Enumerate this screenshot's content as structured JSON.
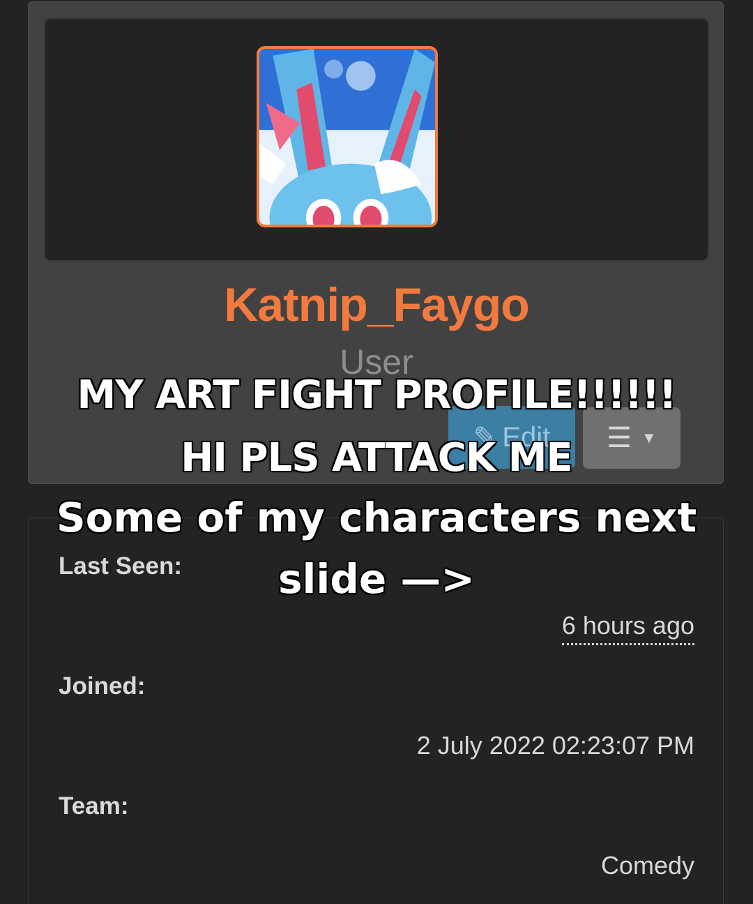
{
  "profile": {
    "username": "Katnip_Faygo",
    "role": "User",
    "edit_label": "Edit",
    "menu_icon": "hamburger-icon",
    "avatar_icon": "avatar-image"
  },
  "details": {
    "last_seen_label": "Last Seen:",
    "last_seen_value": "6 hours ago",
    "joined_label": "Joined:",
    "joined_value": "2 July 2022 02:23:07 PM",
    "team_label": "Team:",
    "team_value": "Comedy"
  },
  "caption": {
    "line1": "MY ART FIGHT PROFILE!!!!!!",
    "line2": "HI PLS ATTACK ME",
    "line3": "Some of my characters next",
    "line4": "slide —>"
  },
  "colors": {
    "accent": "#f37a3e",
    "edit_button": "#3b7fa5",
    "background": "#232323",
    "card": "#424242"
  }
}
